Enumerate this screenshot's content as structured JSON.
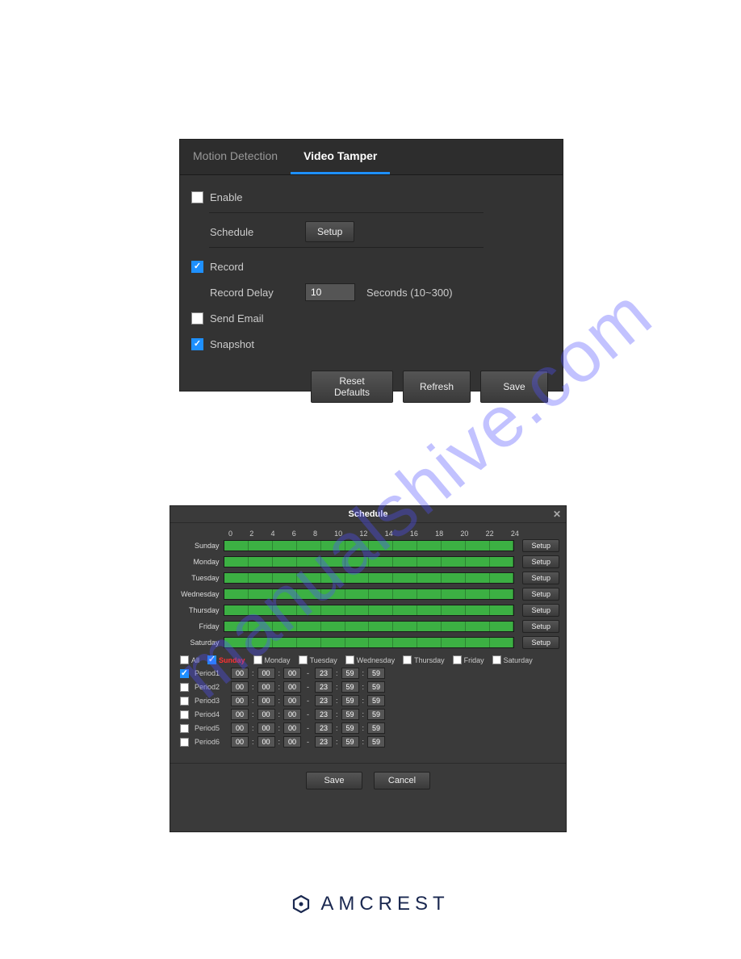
{
  "watermark": "manualshive.com",
  "panel1": {
    "tabs": [
      {
        "label": "Motion Detection",
        "active": false
      },
      {
        "label": "Video Tamper",
        "active": true
      }
    ],
    "enable": {
      "label": "Enable",
      "checked": false
    },
    "schedule": {
      "label": "Schedule",
      "button": "Setup"
    },
    "record": {
      "label": "Record",
      "checked": true
    },
    "record_delay": {
      "label": "Record Delay",
      "value": "10",
      "hint": "Seconds (10~300)"
    },
    "send_email": {
      "label": "Send Email",
      "checked": false
    },
    "snapshot": {
      "label": "Snapshot",
      "checked": true
    },
    "buttons": {
      "reset": "Reset Defaults",
      "refresh": "Refresh",
      "save": "Save"
    }
  },
  "panel2": {
    "title": "Schedule",
    "hours": [
      "0",
      "2",
      "4",
      "6",
      "8",
      "10",
      "12",
      "14",
      "16",
      "18",
      "20",
      "22",
      "24"
    ],
    "days": [
      {
        "name": "Sunday",
        "full": true
      },
      {
        "name": "Monday",
        "full": true
      },
      {
        "name": "Tuesday",
        "full": true
      },
      {
        "name": "Wednesday",
        "full": true
      },
      {
        "name": "Thursday",
        "full": true
      },
      {
        "name": "Friday",
        "full": true
      },
      {
        "name": "Saturday",
        "full": true
      }
    ],
    "setup_label": "Setup",
    "all_label": "All",
    "day_checks": [
      {
        "label": "Sunday",
        "checked": true,
        "highlight": true
      },
      {
        "label": "Monday",
        "checked": false
      },
      {
        "label": "Tuesday",
        "checked": false
      },
      {
        "label": "Wednesday",
        "checked": false
      },
      {
        "label": "Thursday",
        "checked": false
      },
      {
        "label": "Friday",
        "checked": false
      },
      {
        "label": "Saturday",
        "checked": false
      }
    ],
    "periods": [
      {
        "label": "Period1",
        "checked": true,
        "h1": "00",
        "m1": "00",
        "s1": "00",
        "h2": "23",
        "m2": "59",
        "s2": "59"
      },
      {
        "label": "Period2",
        "checked": false,
        "h1": "00",
        "m1": "00",
        "s1": "00",
        "h2": "23",
        "m2": "59",
        "s2": "59"
      },
      {
        "label": "Period3",
        "checked": false,
        "h1": "00",
        "m1": "00",
        "s1": "00",
        "h2": "23",
        "m2": "59",
        "s2": "59"
      },
      {
        "label": "Period4",
        "checked": false,
        "h1": "00",
        "m1": "00",
        "s1": "00",
        "h2": "23",
        "m2": "59",
        "s2": "59"
      },
      {
        "label": "Period5",
        "checked": false,
        "h1": "00",
        "m1": "00",
        "s1": "00",
        "h2": "23",
        "m2": "59",
        "s2": "59"
      },
      {
        "label": "Period6",
        "checked": false,
        "h1": "00",
        "m1": "00",
        "s1": "00",
        "h2": "23",
        "m2": "59",
        "s2": "59"
      }
    ],
    "save": "Save",
    "cancel": "Cancel"
  },
  "brand": "AMCREST"
}
